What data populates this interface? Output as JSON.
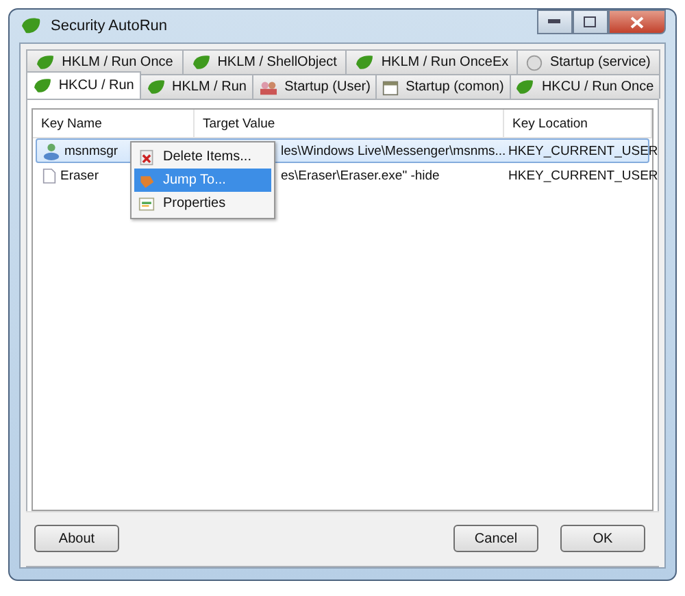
{
  "window": {
    "title": "Security AutoRun"
  },
  "tab_rows": [
    [
      {
        "label": "HKLM / Run Once",
        "kind": "registry",
        "selected": false
      },
      {
        "label": "HKLM / ShellObject",
        "kind": "registry",
        "selected": false
      },
      {
        "label": "HKLM / Run OnceEx",
        "kind": "registry",
        "selected": false
      },
      {
        "label": "Startup (service)",
        "kind": "service",
        "selected": false
      }
    ],
    [
      {
        "label": "HKCU / Run",
        "kind": "registry",
        "selected": true
      },
      {
        "label": "HKLM / Run",
        "kind": "registry",
        "selected": false
      },
      {
        "label": "Startup (User)",
        "kind": "users",
        "selected": false
      },
      {
        "label": "Startup (comon)",
        "kind": "calendar",
        "selected": false
      },
      {
        "label": "HKCU / Run Once",
        "kind": "registry",
        "selected": false
      }
    ]
  ],
  "table": {
    "columns": [
      "Key Name",
      "Target Value",
      "Key Location"
    ],
    "rows": [
      {
        "name": "msnmsgr",
        "kind": "program",
        "target": "les\\Windows Live\\Messenger\\msnms...",
        "location": "HKEY_CURRENT_USER",
        "selected": true
      },
      {
        "name": "Eraser",
        "kind": "file",
        "target": "es\\Eraser\\Eraser.exe\" -hide",
        "location": "HKEY_CURRENT_USER",
        "selected": false
      }
    ]
  },
  "context_menu": [
    {
      "label": "Delete Items...",
      "selected": false
    },
    {
      "label": "Jump To...",
      "selected": true
    },
    {
      "label": "Properties",
      "selected": false
    }
  ],
  "buttons": {
    "left": [
      "About"
    ],
    "right": [
      "Cancel",
      "OK"
    ]
  }
}
